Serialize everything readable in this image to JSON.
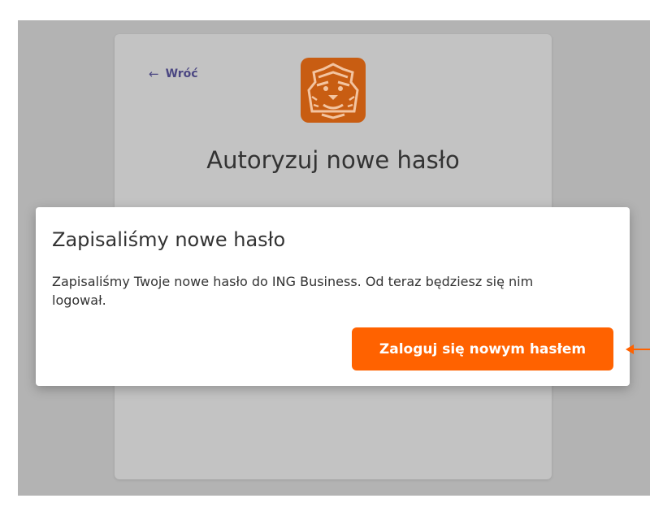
{
  "card": {
    "back_label": "Wróć",
    "back_icon": "arrow-left-icon",
    "title": "Autoryzuj nowe hasło",
    "logo_icon": "ing-lion-logo"
  },
  "modal": {
    "title": "Zapisaliśmy nowe hasło",
    "message": "Zapisaliśmy Twoje nowe hasło do ING Business. Od teraz będziesz się nim logował.",
    "login_button_label": "Zaloguj się nowym hasłem"
  },
  "colors": {
    "accent": "#ff6200",
    "logo_background": "#c85d12",
    "link": "#4b4782",
    "overlay": "#b3b3b3",
    "pointer_arrow": "#ff6200"
  }
}
